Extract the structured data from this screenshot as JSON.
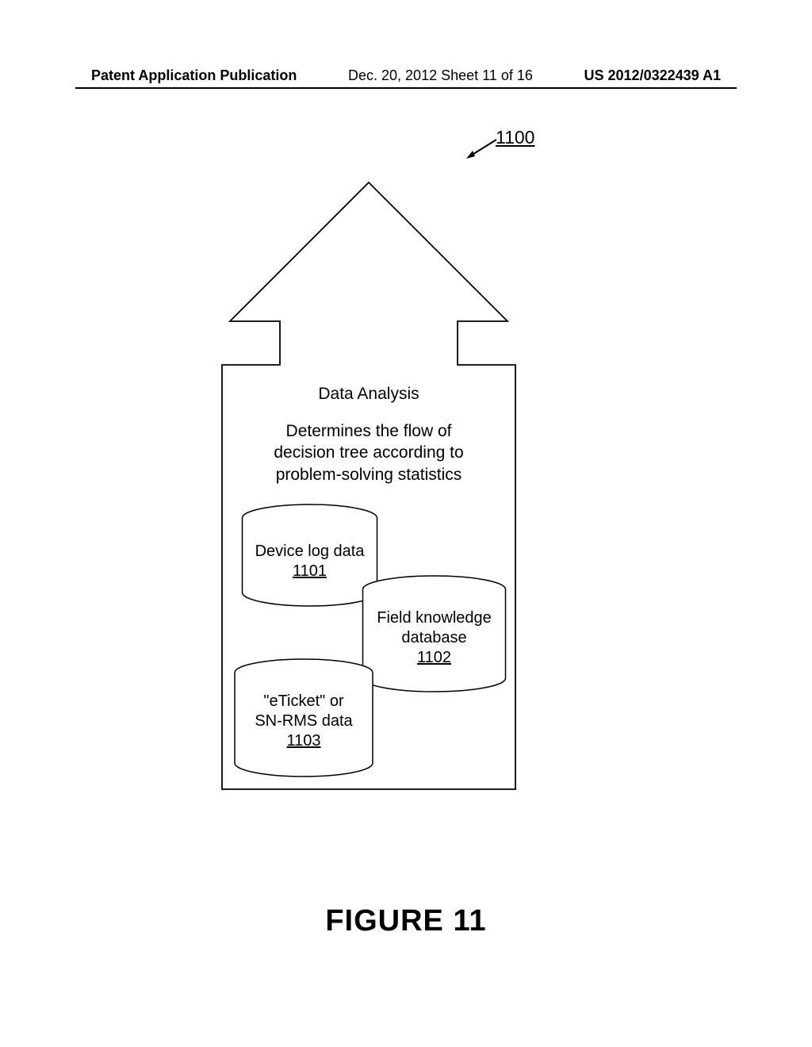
{
  "header": {
    "left": "Patent Application Publication",
    "center": "Dec. 20, 2012  Sheet 11 of 16",
    "right": "US 2012/0322439 A1"
  },
  "diagram": {
    "reference_number": "1100",
    "title": "Data Analysis",
    "description_line1": "Determines the flow of",
    "description_line2": "decision tree according to",
    "description_line3": "problem-solving statistics",
    "cylinders": [
      {
        "label": "Device log data",
        "ref": "1101"
      },
      {
        "label_line1": "Field knowledge",
        "label_line2": "database",
        "ref": "1102"
      },
      {
        "label_line1": "\"eTicket\" or",
        "label_line2": "SN-RMS data",
        "ref": "1103"
      }
    ]
  },
  "caption": "FIGURE 11"
}
